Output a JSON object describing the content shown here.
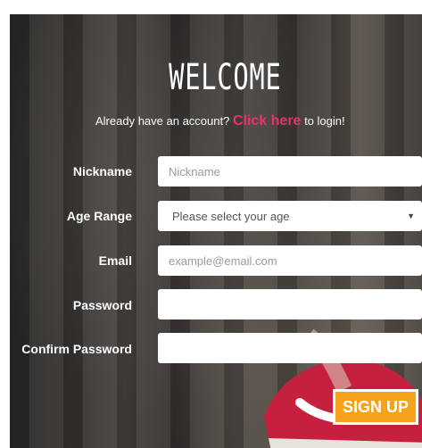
{
  "header": {
    "title": "WELCOME",
    "login_prompt_prefix": "Already have an account?",
    "login_link": "Click here",
    "login_prompt_suffix": "to login!"
  },
  "form": {
    "nickname": {
      "label": "Nickname",
      "placeholder": "Nickname"
    },
    "age_range": {
      "label": "Age Range",
      "selected": "Please select your age"
    },
    "email": {
      "label": "Email",
      "placeholder": "example@email.com"
    },
    "password": {
      "label": "Password",
      "placeholder": ""
    },
    "confirm_password": {
      "label": "Confirm Password",
      "placeholder": ""
    },
    "submit_label": "SIGN UP"
  },
  "icons": {
    "select_arrow": "chevron-down-icon"
  },
  "colors": {
    "accent_link": "#e8336b",
    "button": "#f7a21b"
  }
}
